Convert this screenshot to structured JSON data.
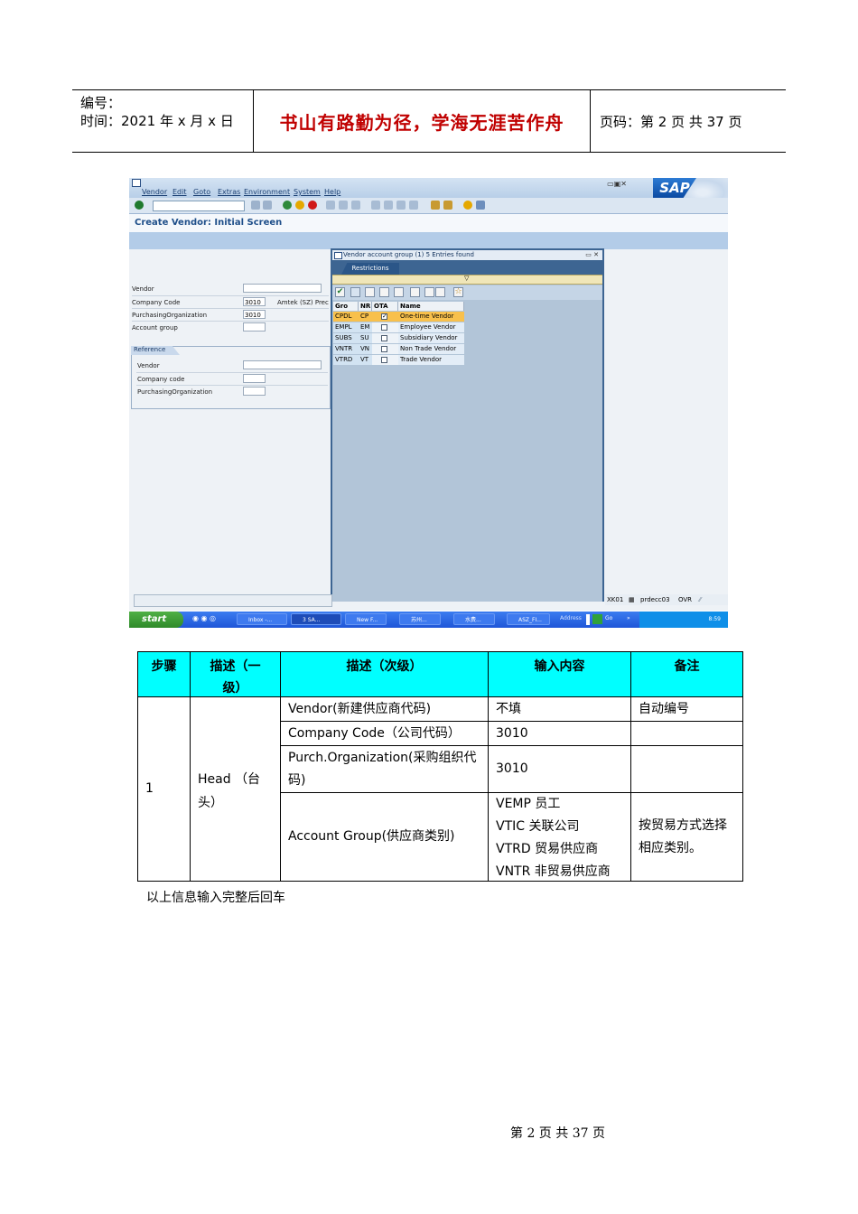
{
  "doc_header": {
    "number_label": "编号：",
    "time_label": "时间：2021 年 x 月 x 日",
    "motto": "书山有路勤为径，学海无涯苦作舟",
    "page_info": "页码：第 2 页  共 37 页"
  },
  "sap": {
    "menu": [
      "Vendor",
      "Edit",
      "Goto",
      "Extras",
      "Environment",
      "System",
      "Help"
    ],
    "logo_text": "SAP",
    "screen_title": "Create Vendor: Initial Screen",
    "fields": {
      "vendor_label": "Vendor",
      "company_code_label": "Company Code",
      "company_code_value": "3010",
      "company_name": "Amtek (SZ) Prec",
      "purch_org_label": "PurchasingOrganization",
      "purch_org_value": "3010",
      "account_group_label": "Account group"
    },
    "reference": {
      "title": "Reference",
      "vendor_label": "Vendor",
      "company_code_label": "Company code",
      "purch_org_label": "PurchasingOrganization"
    },
    "popup": {
      "title": "Vendor account group (1)   5 Entries found",
      "tab": "Restrictions",
      "columns": [
        "Gro",
        "NR",
        "OTA",
        "Name"
      ],
      "rows": [
        {
          "group": "CPDL",
          "nr": "CP",
          "ota": true,
          "name": "One-time Vendor"
        },
        {
          "group": "EMPL",
          "nr": "EM",
          "ota": false,
          "name": "Employee Vendor"
        },
        {
          "group": "SUBS",
          "nr": "SU",
          "ota": false,
          "name": "Subsidiary Vendor"
        },
        {
          "group": "VNTR",
          "nr": "VN",
          "ota": false,
          "name": "Non Trade Vendor"
        },
        {
          "group": "VTRD",
          "nr": "VT",
          "ota": false,
          "name": "Trade Vendor"
        }
      ],
      "selected_index": 0
    },
    "status": {
      "transaction": "XK01",
      "server": "prdecc03",
      "mode": "OVR"
    },
    "taskbar": {
      "start": "start",
      "tasks": [
        "Inbox -...",
        "3 SA...",
        "New F...",
        "苏州...",
        "水费...",
        "ASZ_FI..."
      ],
      "address_label": "Address",
      "go_label": "Go",
      "time": "8:59"
    }
  },
  "steps_table": {
    "headers": {
      "step": "步骤",
      "desc1": "描述（一级）",
      "desc2": "描述（次级）",
      "input": "输入内容",
      "remark": "备注"
    },
    "step_no": "1",
    "level1": "Head （台头）",
    "rows": [
      {
        "desc": "Vendor(新建供应商代码)",
        "input": "不填",
        "remark": "自动编号"
      },
      {
        "desc": "Company Code（公司代码）",
        "input": "3010",
        "remark": ""
      },
      {
        "desc": "Purch.Organization(采购组织代码)",
        "input": "3010",
        "remark": ""
      }
    ],
    "account_group": {
      "desc": "Account Group(供应商类别)",
      "inputs": [
        "VEMP  员工",
        "VTIC  关联公司",
        "VTRD  贸易供应商",
        "VNTR  非贸易供应商"
      ],
      "remark": "按贸易方式选择相应类别。"
    }
  },
  "after_note": "以上信息输入完整后回车",
  "footer": "第 2 页 共 37 页"
}
